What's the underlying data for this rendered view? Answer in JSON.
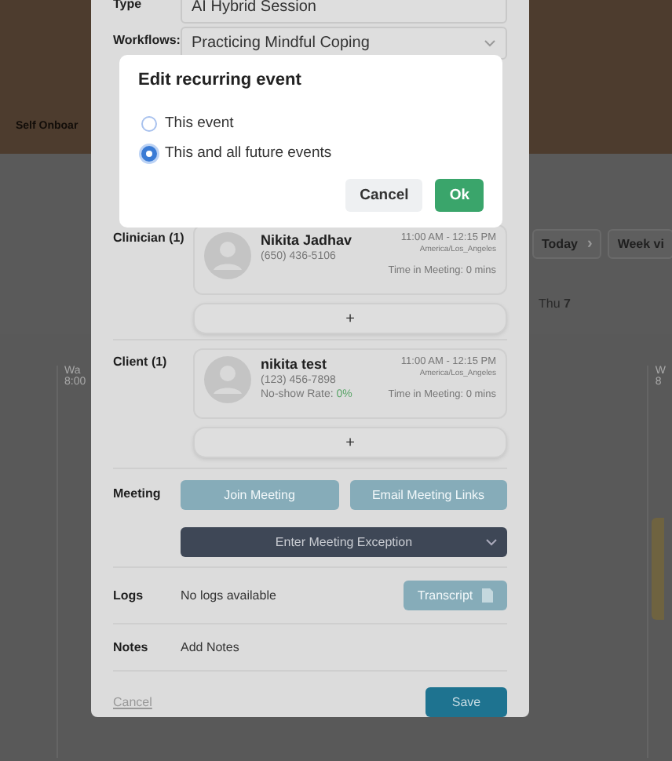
{
  "background": {
    "sidebar_label": "Self Onboar",
    "nav": {
      "today": "Today",
      "next": "›",
      "view": "Week vi"
    },
    "day_header": "Thu **7**",
    "calendar_cells": [
      {
        "title": "Wa",
        "time": "8:00"
      },
      {
        "title": "W",
        "time": "8"
      }
    ]
  },
  "modal": {
    "type": {
      "label": "Type",
      "value": "AI Hybrid Session"
    },
    "workflows": {
      "label": "Workflows:",
      "value": "Practicing Mindful Coping"
    },
    "participants": [
      {
        "label": "Clinician (1)",
        "name": "Nikita Jadhav",
        "phone": "(650) 436-5106",
        "time": "11:00 AM - 12:15 PM",
        "timezone": "America/Los_Angeles",
        "meeting_time": "Time in Meeting: 0 mins",
        "add": "+"
      },
      {
        "label": "Client (1)",
        "name": "nikita test",
        "phone": "(123) 456-7898",
        "no_show_label": "No-show Rate:",
        "no_show_value": "0%",
        "time": "11:00 AM - 12:15 PM",
        "timezone": "America/Los_Angeles",
        "meeting_time": "Time in Meeting: 0 mins",
        "add": "+"
      }
    ],
    "meeting": {
      "label": "Meeting",
      "buttons": [
        "Join Meeting",
        "Email Meeting Links"
      ],
      "exception": "Enter Meeting Exception"
    },
    "logs": {
      "label": "Logs",
      "text": "No logs available",
      "button": "Transcript"
    },
    "notes": {
      "label": "Notes",
      "placeholder": "Add Notes"
    },
    "cancel": "Cancel",
    "save": "Save"
  },
  "dialog": {
    "title": "Edit recurring event",
    "options": [
      {
        "label": "This event",
        "selected": false
      },
      {
        "label": "This and all future events",
        "selected": true
      }
    ],
    "cancel": "Cancel",
    "ok": "Ok"
  }
}
